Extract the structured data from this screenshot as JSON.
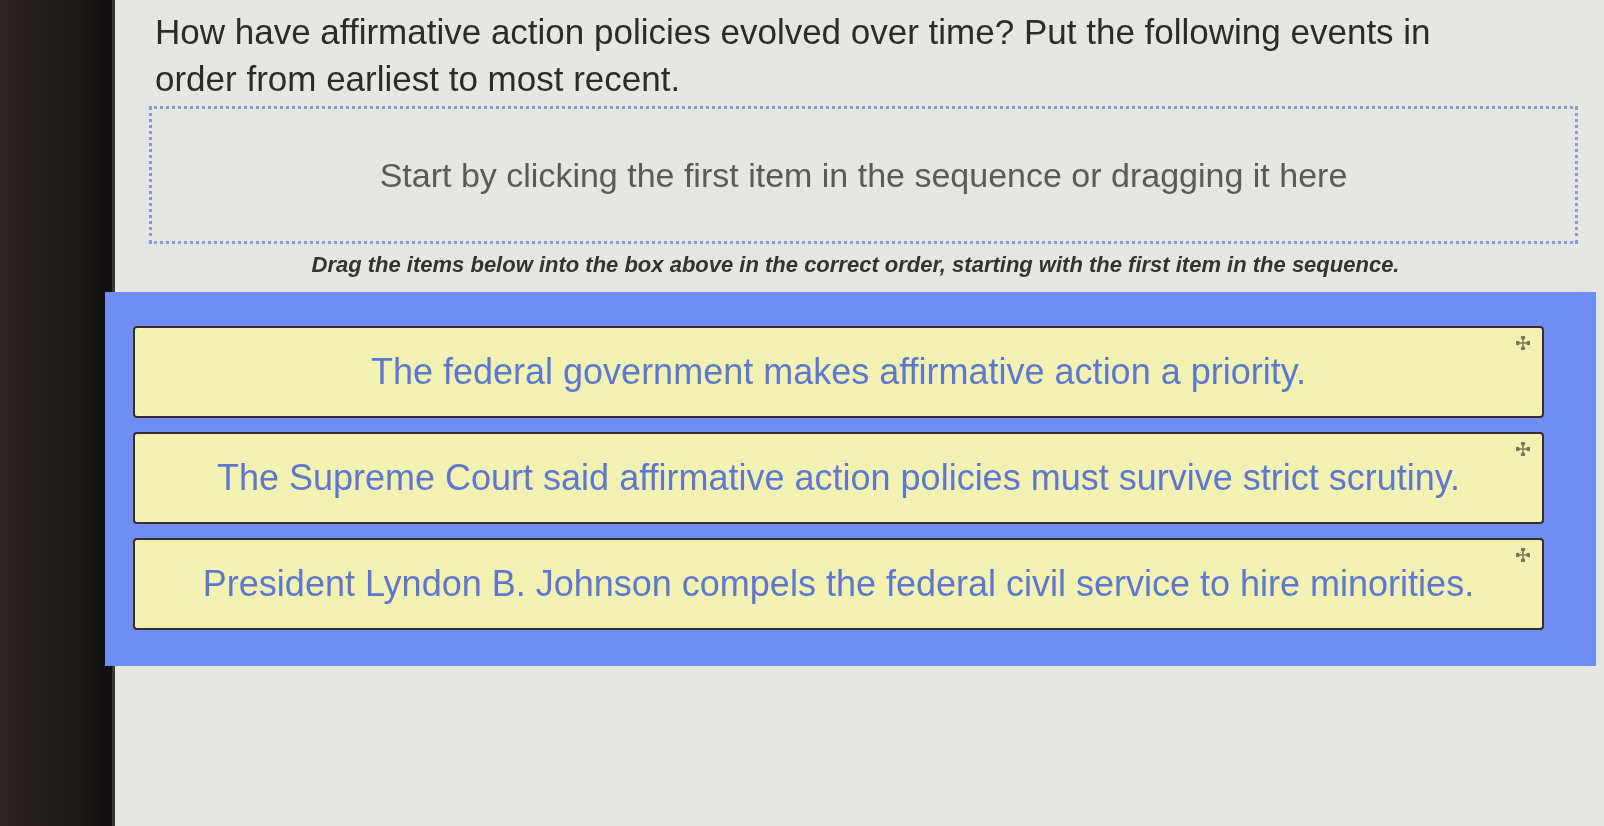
{
  "question": "How have affirmative action policies evolved over time? Put the following events in order from earliest to most recent.",
  "drop_zone": {
    "placeholder": "Start by clicking the first item in the sequence or dragging it here"
  },
  "instruction": "Drag the items below into the box above in the correct order, starting with the first item in the sequence.",
  "items": [
    {
      "label": "The federal government makes affirmative action a priority."
    },
    {
      "label": "The Supreme Court said affirmative action policies must survive strict scrutiny."
    },
    {
      "label": "President Lyndon B. Johnson compels the federal civil service to hire minorities."
    }
  ]
}
